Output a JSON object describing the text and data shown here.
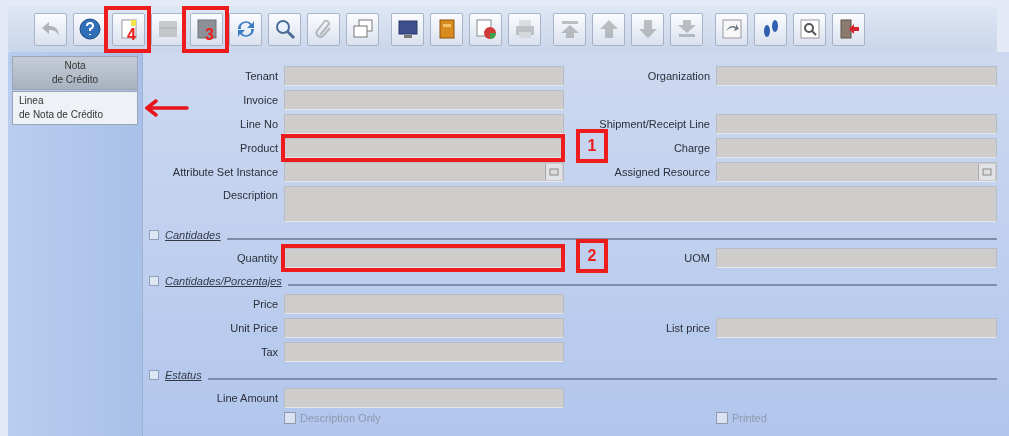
{
  "toolbar": {
    "groups": [
      {
        "buttons": [
          {
            "kind": "undo",
            "disabled": true
          },
          {
            "kind": "help",
            "disabled": false
          },
          {
            "kind": "new",
            "disabled": false,
            "callout": "4"
          },
          {
            "kind": "copy",
            "disabled": true
          },
          {
            "kind": "delete",
            "disabled": false,
            "callout": "3"
          },
          {
            "kind": "refresh",
            "disabled": false
          },
          {
            "kind": "find",
            "disabled": false
          },
          {
            "kind": "attachment",
            "disabled": true
          },
          {
            "kind": "chat",
            "disabled": false
          }
        ]
      },
      {
        "buttons": [
          {
            "kind": "report",
            "disabled": false
          },
          {
            "kind": "archive",
            "disabled": false
          },
          {
            "kind": "preview",
            "disabled": false
          },
          {
            "kind": "print",
            "disabled": true
          }
        ]
      },
      {
        "buttons": [
          {
            "kind": "first",
            "disabled": true
          },
          {
            "kind": "previous",
            "disabled": true
          },
          {
            "kind": "next",
            "disabled": true
          },
          {
            "kind": "last",
            "disabled": true
          }
        ]
      },
      {
        "buttons": [
          {
            "kind": "history",
            "disabled": false
          },
          {
            "kind": "info",
            "disabled": false
          },
          {
            "kind": "zoom",
            "disabled": false
          },
          {
            "kind": "exit",
            "disabled": false
          }
        ]
      }
    ]
  },
  "tabs": [
    {
      "label": "Nota\nde Crédito",
      "selected": false,
      "pointer": false
    },
    {
      "label": "Linea\nde Nota de Crédito",
      "selected": true,
      "pointer": true
    }
  ],
  "form": {
    "items": [
      {
        "kind": "row",
        "left": {
          "label": "Tenant",
          "lookup": false
        },
        "right": {
          "label": "Organization",
          "lookup": false
        }
      },
      {
        "kind": "row",
        "left": {
          "label": "Invoice",
          "lookup": false
        }
      },
      {
        "kind": "row",
        "left": {
          "label": "Line No",
          "lookup": false
        },
        "right": {
          "label": "Shipment/Receipt Line",
          "lookup": false
        }
      },
      {
        "kind": "row",
        "left": {
          "label": "Product",
          "lookup": false,
          "callout": "1"
        },
        "right": {
          "label": "Charge",
          "lookup": false
        }
      },
      {
        "kind": "row",
        "left": {
          "label": "Attribute Set Instance",
          "lookup": true
        },
        "right": {
          "label": "Assigned Resource",
          "lookup": true
        }
      },
      {
        "kind": "wide",
        "label": "Description"
      },
      {
        "kind": "section",
        "title": "Cantidades"
      },
      {
        "kind": "row",
        "left": {
          "label": "Quantity",
          "lookup": false,
          "callout": "2"
        },
        "right": {
          "label": "UOM",
          "lookup": false
        }
      },
      {
        "kind": "section",
        "title": "Cantidades/Porcentajes"
      },
      {
        "kind": "row",
        "left": {
          "label": "Price",
          "lookup": false
        }
      },
      {
        "kind": "row",
        "left": {
          "label": "Unit Price",
          "lookup": false
        },
        "right": {
          "label": "List price",
          "lookup": false
        }
      },
      {
        "kind": "row",
        "left": {
          "label": "Tax",
          "lookup": false
        }
      },
      {
        "kind": "section",
        "title": "Estatus"
      },
      {
        "kind": "row",
        "left": {
          "label": "Line Amount",
          "lookup": false
        }
      },
      {
        "kind": "checks",
        "left": {
          "label": "Description Only",
          "checked": false,
          "disabled": true
        },
        "right": {
          "label": "Printed",
          "checked": false,
          "disabled": true
        }
      }
    ]
  }
}
